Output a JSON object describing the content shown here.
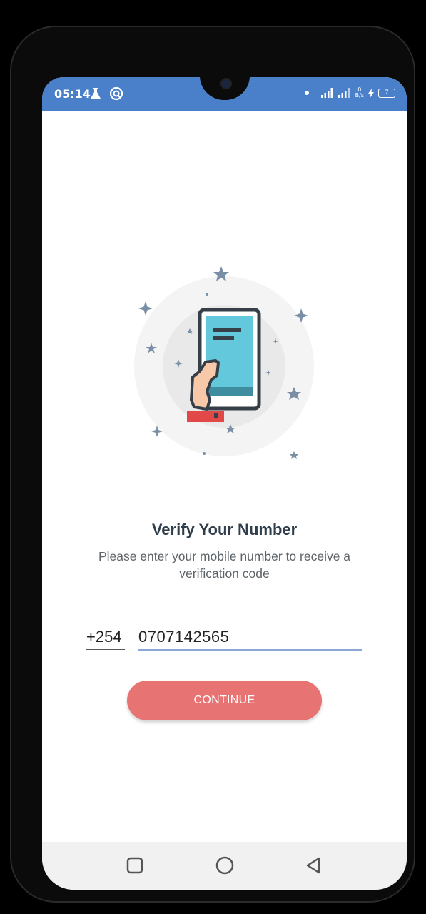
{
  "status_bar": {
    "time": "05:14",
    "net_speed_value": "0",
    "net_speed_unit": "B/s",
    "battery": "7",
    "icons": [
      "flask-icon",
      "vpn-icon",
      "dot-icon",
      "signal-icon",
      "signal-icon",
      "charging-icon",
      "battery-icon"
    ]
  },
  "verify": {
    "title": "Verify Your Number",
    "subtitle": "Please enter your mobile number to receive a verification code"
  },
  "form": {
    "country_code": "+254",
    "phone_number": "0707142565",
    "continue_label": "CONTINUE"
  },
  "colors": {
    "status_bar": "#4a7fc9",
    "button": "#e77373",
    "title": "#2f3e4a",
    "input_underline": "#8aa7d6"
  },
  "navigation": {
    "buttons": [
      "square-recents-icon",
      "circle-home-icon",
      "triangle-back-icon"
    ]
  }
}
